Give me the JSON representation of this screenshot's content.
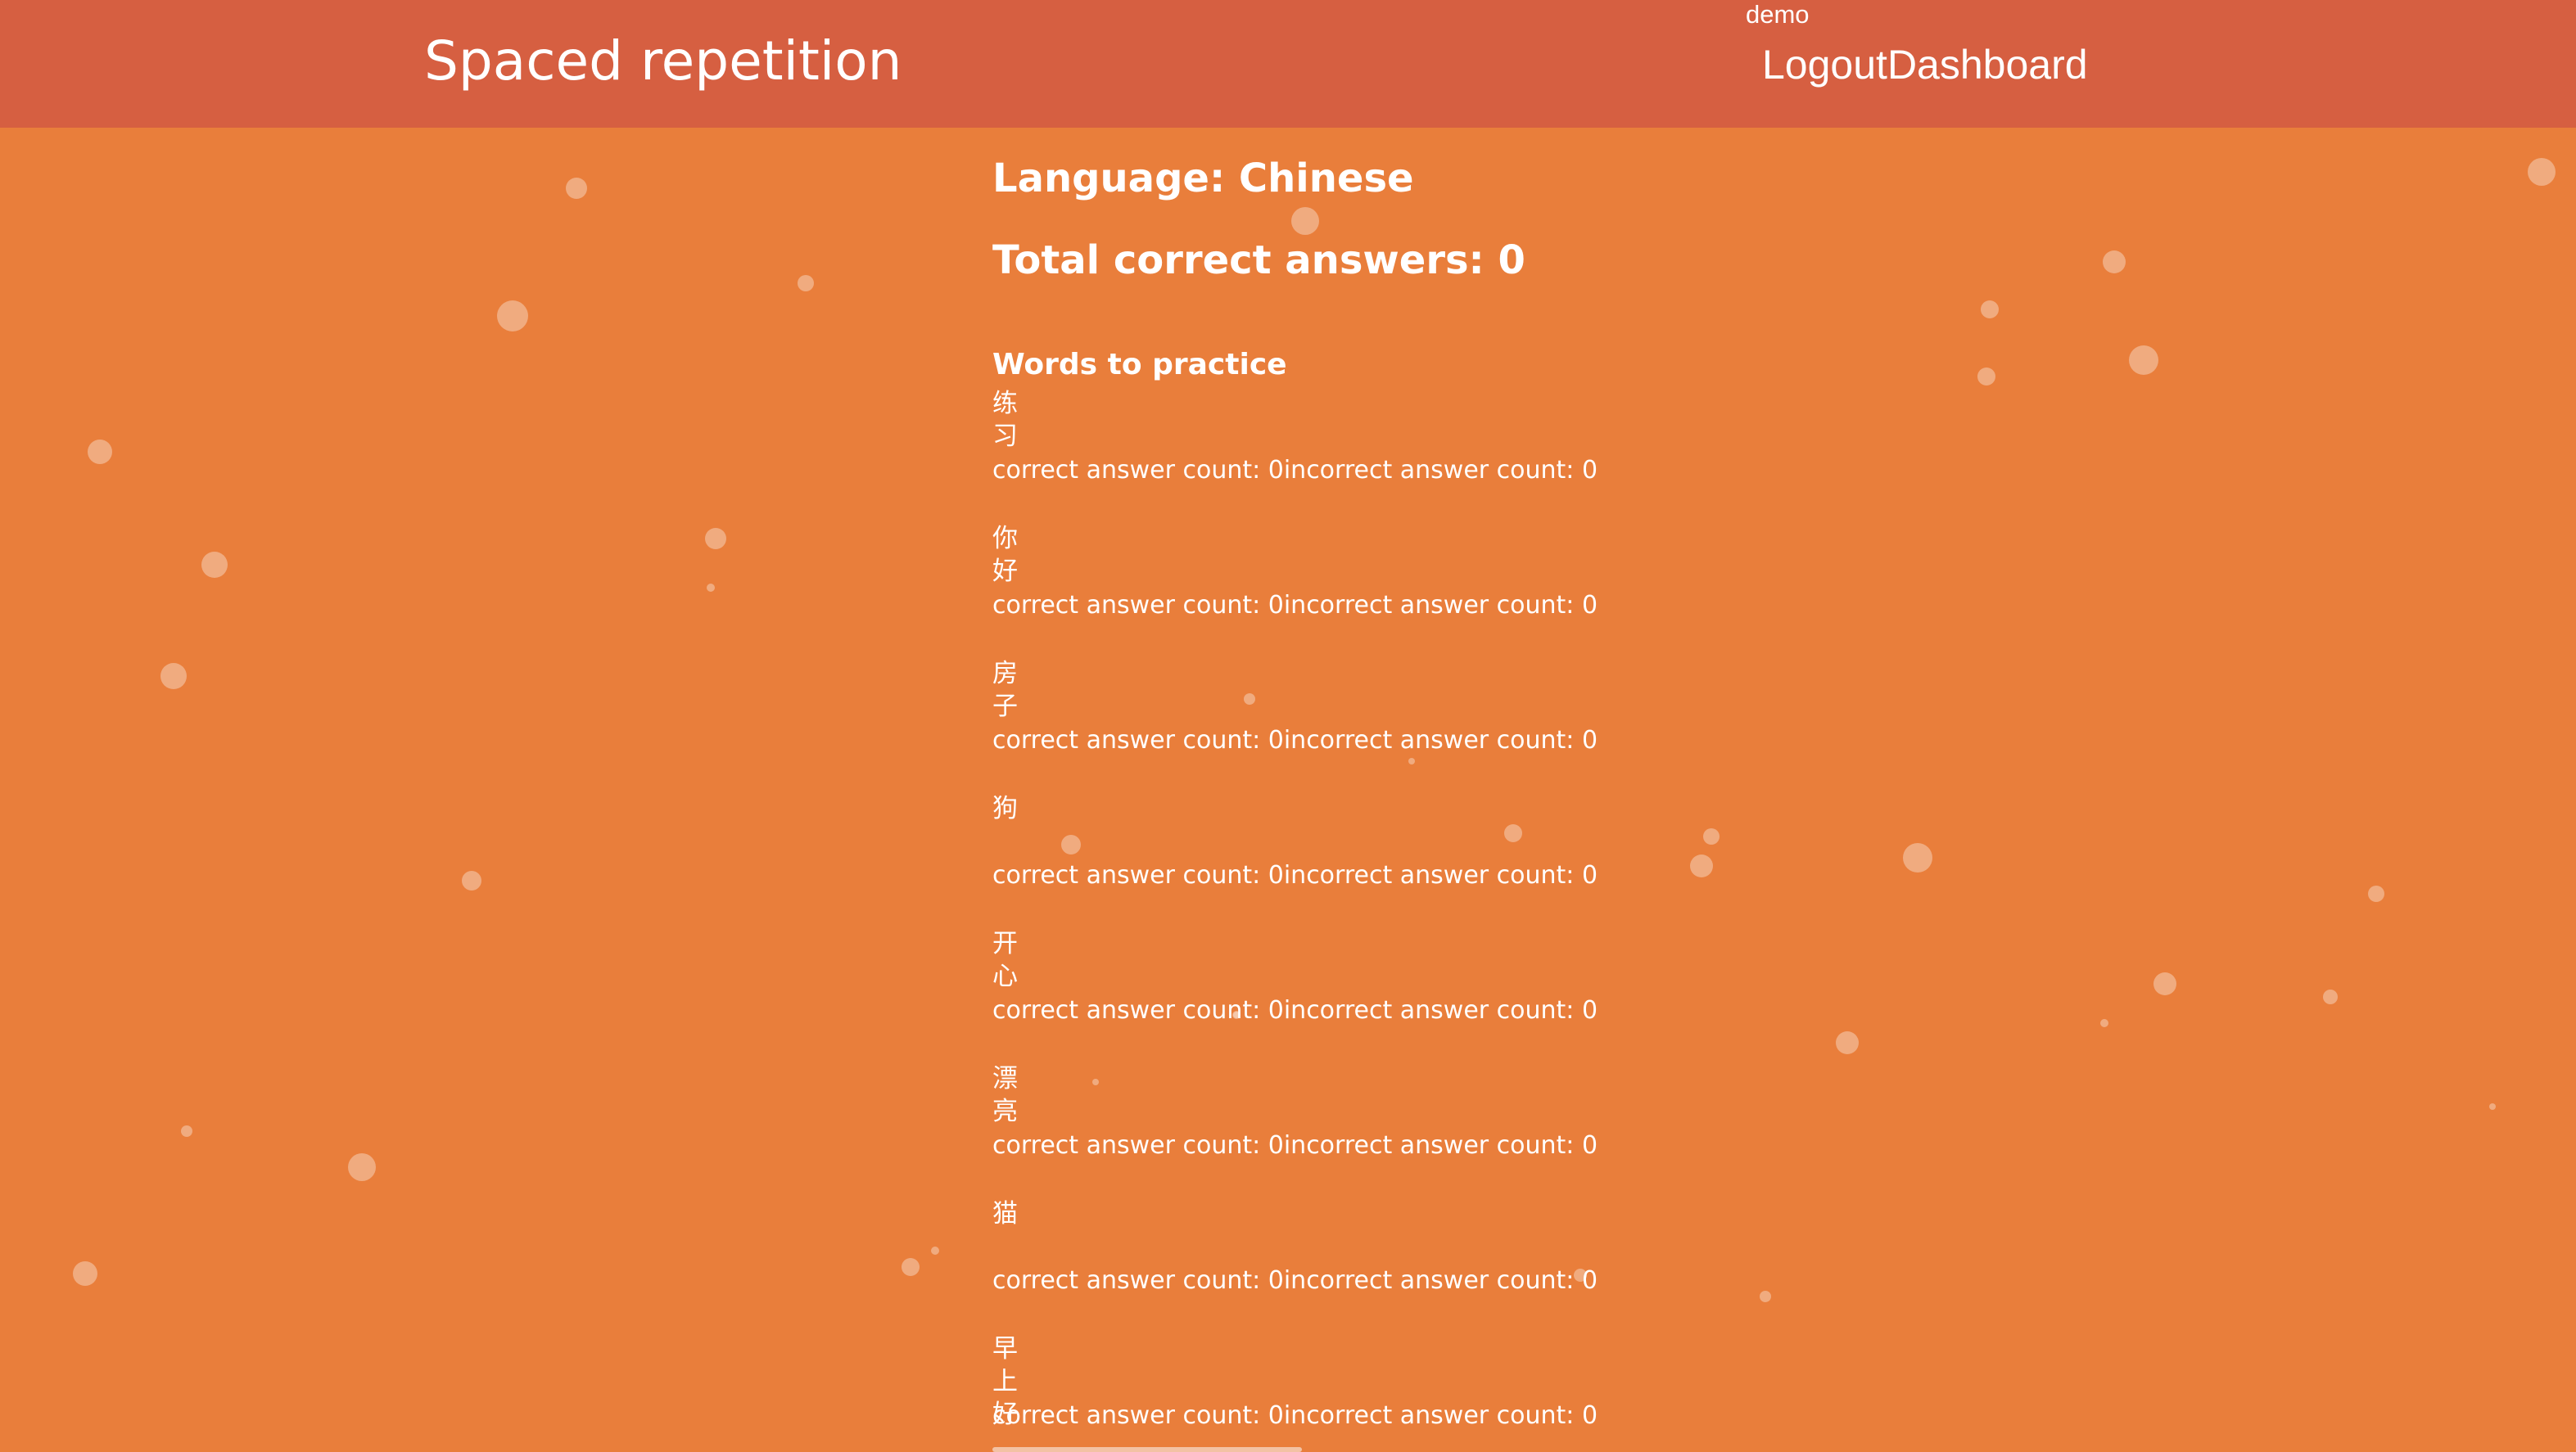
{
  "header": {
    "brand": "Spaced repetition",
    "username": "demo",
    "nav": {
      "logout": "Logout",
      "dashboard": "Dashboard"
    }
  },
  "main": {
    "language": "Language: Chinese",
    "total": "Total correct answers: 0",
    "words_heading": "Words to practice",
    "words": [
      {
        "word": "练习",
        "correct": "correct answer count: 0",
        "incorrect": "incorrect answer count: 0"
      },
      {
        "word": "你好",
        "correct": "correct answer count: 0",
        "incorrect": "incorrect answer count: 0"
      },
      {
        "word": "房子",
        "correct": "correct answer count: 0",
        "incorrect": "incorrect answer count: 0"
      },
      {
        "word": "狗",
        "correct": "correct answer count: 0",
        "incorrect": "incorrect answer count: 0"
      },
      {
        "word": "开心",
        "correct": "correct answer count: 0",
        "incorrect": "incorrect answer count: 0"
      },
      {
        "word": "漂亮",
        "correct": "correct answer count: 0",
        "incorrect": "incorrect answer count: 0"
      },
      {
        "word": "猫",
        "correct": "correct answer count: 0",
        "incorrect": "incorrect answer count: 0"
      },
      {
        "word": "早上好",
        "correct": "correct answer count: 0",
        "incorrect": "incorrect answer count: 0"
      }
    ]
  },
  "colors": {
    "background": "#e97e3b",
    "header": "#d65f41",
    "text": "#ffffff"
  }
}
